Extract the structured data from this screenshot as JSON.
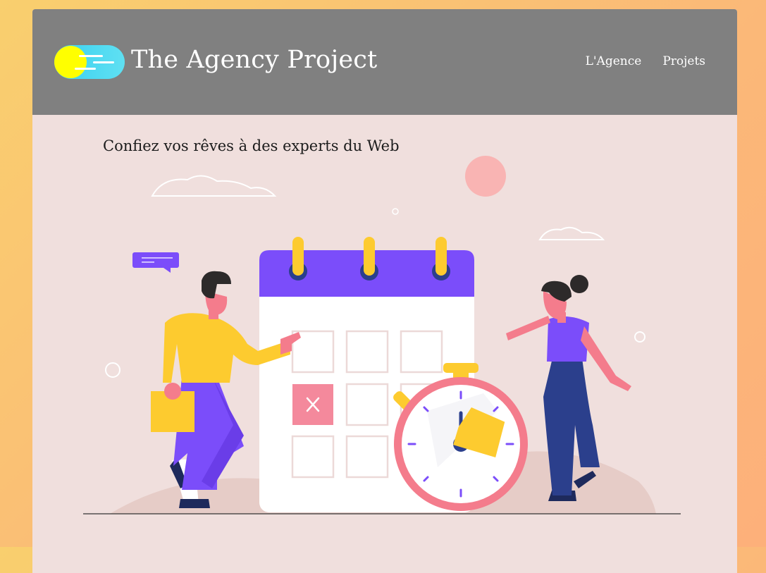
{
  "header": {
    "title": "The Agency Project",
    "logo_icon": "sun-cloud-logo"
  },
  "nav": {
    "items": [
      {
        "label": "L'Agence"
      },
      {
        "label": "Projets"
      }
    ]
  },
  "main": {
    "tagline": "Confiez vos rêves à des experts du Web",
    "illustration": "calendar-stopwatch-team-illustration"
  },
  "colors": {
    "background_gradient": [
      "#f9cf6e",
      "#fdb07a"
    ],
    "header": "#808080",
    "content": "#f0dfdd",
    "purple": "#7b4dfa",
    "yellow": "#fdcb2f",
    "pink": "#f47c8c"
  }
}
